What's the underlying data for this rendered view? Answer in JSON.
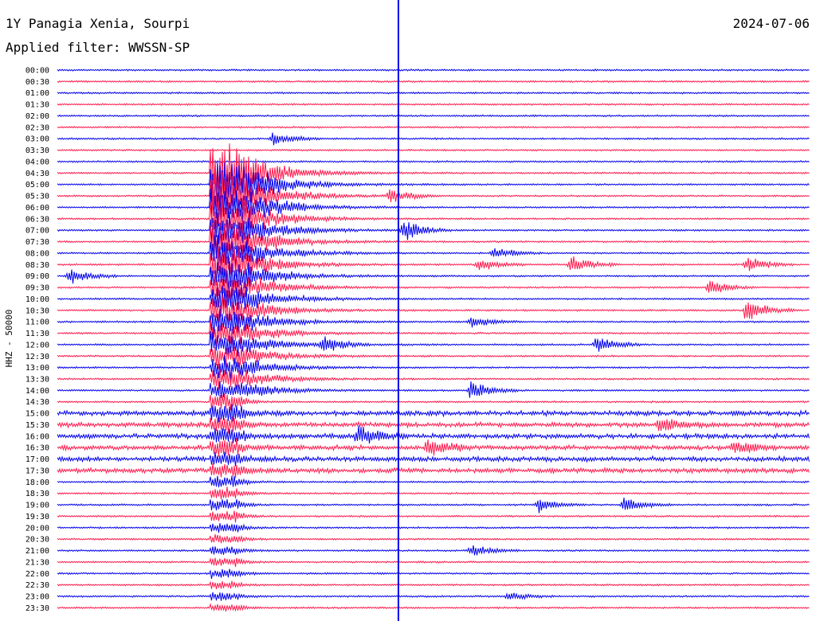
{
  "header": {
    "station": "1Y Panagia Xenia, Sourpi",
    "date": "2024-07-06",
    "filter": "Applied filter: WWSSN-SP"
  },
  "chart_data": {
    "type": "line",
    "title": "1Y Panagia Xenia, Sourpi",
    "ylabel": "HHZ - 50000",
    "rows": [
      "00:00",
      "00:30",
      "01:00",
      "01:30",
      "02:00",
      "02:30",
      "03:00",
      "03:30",
      "04:00",
      "04:30",
      "05:00",
      "05:30",
      "06:00",
      "06:30",
      "07:00",
      "07:30",
      "08:00",
      "08:30",
      "09:00",
      "09:30",
      "10:00",
      "10:30",
      "11:00",
      "11:30",
      "12:00",
      "12:30",
      "13:00",
      "13:30",
      "14:00",
      "14:30",
      "15:00",
      "15:30",
      "16:00",
      "16:30",
      "17:00",
      "17:30",
      "18:00",
      "18:30",
      "19:00",
      "19:30",
      "20:00",
      "20:30",
      "21:00",
      "21:30",
      "22:00",
      "22:30",
      "23:00",
      "23:30"
    ],
    "series_colors": [
      "#0000ee",
      "#ff1a4d"
    ],
    "marker_color": "#0000ee",
    "x_minutes": [
      0,
      30
    ],
    "marker_minute": 13.6,
    "events": [
      {
        "row": 6,
        "minute": 8.6,
        "amp": 10
      },
      {
        "row": 11,
        "minute": 13.3,
        "amp": 12
      },
      {
        "row": 14,
        "minute": 13.8,
        "amp": 16
      },
      {
        "row": 16,
        "minute": 17.4,
        "amp": 9
      },
      {
        "row": 17,
        "minute": 16.8,
        "amp": 10
      },
      {
        "row": 17,
        "minute": 20.5,
        "amp": 14
      },
      {
        "row": 17,
        "minute": 27.5,
        "amp": 12
      },
      {
        "row": 18,
        "minute": 0.5,
        "amp": 12
      },
      {
        "row": 19,
        "minute": 26.0,
        "amp": 12
      },
      {
        "row": 21,
        "minute": 27.5,
        "amp": 18
      },
      {
        "row": 22,
        "minute": 16.5,
        "amp": 8
      },
      {
        "row": 24,
        "minute": 10.6,
        "amp": 12
      },
      {
        "row": 24,
        "minute": 21.5,
        "amp": 12
      },
      {
        "row": 28,
        "minute": 16.5,
        "amp": 14
      },
      {
        "row": 31,
        "minute": 24.0,
        "amp": 12
      },
      {
        "row": 32,
        "minute": 12.0,
        "amp": 16
      },
      {
        "row": 33,
        "minute": 14.8,
        "amp": 14
      },
      {
        "row": 33,
        "minute": 27.0,
        "amp": 10
      },
      {
        "row": 38,
        "minute": 19.2,
        "amp": 10
      },
      {
        "row": 38,
        "minute": 22.6,
        "amp": 12
      },
      {
        "row": 42,
        "minute": 16.5,
        "amp": 9
      },
      {
        "row": 46,
        "minute": 18.0,
        "amp": 6
      }
    ],
    "mainshock": {
      "row": 9,
      "minute": 6.5
    }
  }
}
